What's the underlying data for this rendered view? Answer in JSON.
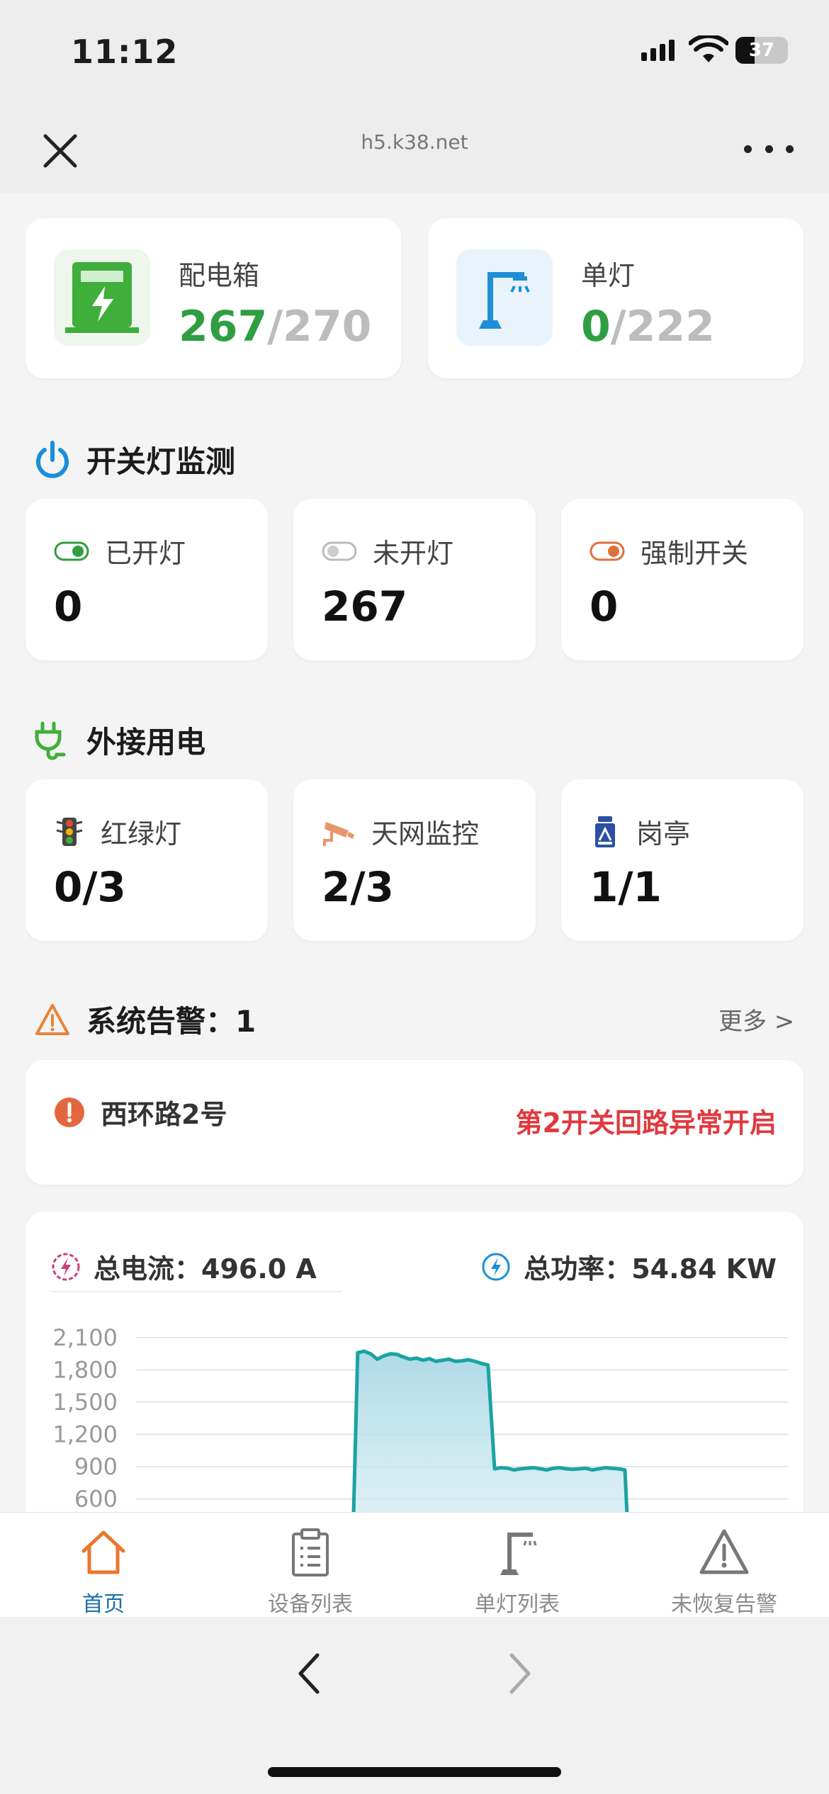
{
  "status": {
    "time": "11:12",
    "battery": "37",
    "battery_level": 0.37
  },
  "browser": {
    "url": "h5.k38.net"
  },
  "top_cards": [
    {
      "label": "配电箱",
      "online": "267",
      "total": "270",
      "icon": "distribution-box-icon"
    },
    {
      "label": "单灯",
      "online": "0",
      "total": "222",
      "icon": "street-lamp-icon"
    }
  ],
  "separator": "/",
  "switch_monitor": {
    "title": "开关灯监测",
    "items": [
      {
        "label": "已开灯",
        "value": "0",
        "icon": "toggle-on-icon",
        "color": "#2f9e41"
      },
      {
        "label": "未开灯",
        "value": "267",
        "icon": "toggle-off-icon",
        "color": "#bbbbbb"
      },
      {
        "label": "强制开关",
        "value": "0",
        "icon": "toggle-forced-icon",
        "color": "#e0703a"
      }
    ]
  },
  "external_power": {
    "title": "外接用电",
    "items": [
      {
        "label": "红绿灯",
        "value": "0/3",
        "icon": "traffic-light-icon"
      },
      {
        "label": "天网监控",
        "value": "2/3",
        "icon": "surveillance-camera-icon"
      },
      {
        "label": "岗亭",
        "value": "1/1",
        "icon": "guard-booth-icon"
      }
    ]
  },
  "alarms": {
    "title": "系统告警：1",
    "more": "更多 >",
    "items": [
      {
        "name": "西环路2号",
        "message": "第2开关回路异常开启"
      }
    ]
  },
  "metrics": {
    "current_label": "总电流：496.0 A",
    "power_label": "总功率：54.84 KW"
  },
  "chart_data": {
    "type": "area",
    "title": "",
    "xlabel": "",
    "ylabel": "",
    "y_ticks": [
      "2,100",
      "1,800",
      "1,500",
      "1,200",
      "900",
      "600"
    ],
    "ylim": [
      600,
      2100
    ],
    "grid": true,
    "color": "#1aa3a3",
    "x": [
      0,
      8,
      16,
      24,
      33,
      34,
      35,
      36,
      37,
      38,
      39,
      40,
      41,
      42,
      43,
      44,
      45,
      46,
      47,
      48,
      49,
      50,
      51,
      52,
      53,
      54,
      55,
      56,
      57,
      58,
      59,
      60,
      61,
      62,
      63,
      64,
      65,
      66,
      67,
      68,
      69,
      70,
      71,
      72,
      73,
      74,
      75,
      76,
      77,
      78,
      79,
      80,
      81,
      82,
      83,
      84,
      85,
      86,
      87,
      88,
      89,
      90,
      91,
      92,
      93,
      94,
      95,
      96,
      97,
      98,
      99,
      100
    ],
    "values": [
      0,
      0,
      0,
      0,
      0,
      1960,
      1975,
      1950,
      1900,
      1930,
      1950,
      1945,
      1920,
      1900,
      1910,
      1890,
      1905,
      1880,
      1890,
      1900,
      1880,
      1885,
      1895,
      1880,
      1860,
      1845,
      880,
      890,
      885,
      870,
      880,
      885,
      890,
      880,
      870,
      885,
      890,
      880,
      875,
      880,
      885,
      870,
      880,
      890,
      885,
      880,
      870,
      0,
      0,
      0,
      0,
      0,
      0,
      0,
      0,
      0,
      0,
      0,
      0,
      0,
      0,
      0,
      0,
      0,
      0,
      0,
      0,
      0,
      0,
      0,
      0,
      0
    ]
  },
  "tabs": [
    {
      "label": "首页",
      "icon": "home-icon",
      "active": true
    },
    {
      "label": "设备列表",
      "icon": "clipboard-list-icon",
      "active": false
    },
    {
      "label": "单灯列表",
      "icon": "lamp-post-icon",
      "active": false
    },
    {
      "label": "未恢复告警",
      "icon": "warning-triangle-icon",
      "active": false
    }
  ]
}
